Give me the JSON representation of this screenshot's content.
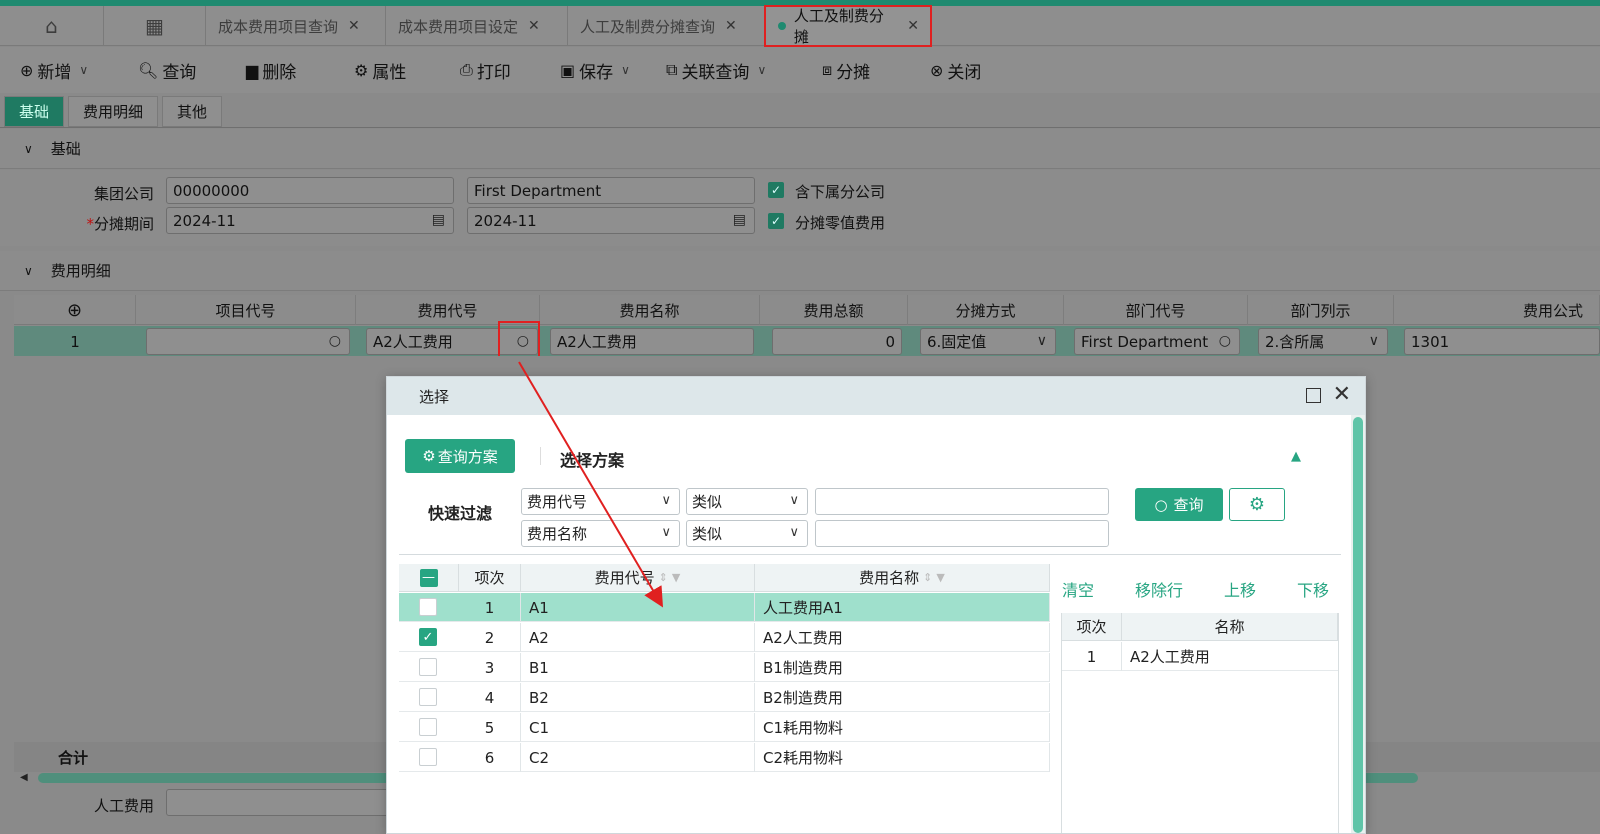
{
  "tabs": [
    {
      "label": "成本费用项目查询"
    },
    {
      "label": "成本费用项目设定"
    },
    {
      "label": "人工及制费分摊查询"
    },
    {
      "label": "人工及制费分摊"
    }
  ],
  "toolbar": {
    "new": "新增",
    "query": "查询",
    "delete": "删除",
    "properties": "属性",
    "print": "打印",
    "save": "保存",
    "related_query": "关联查询",
    "allocate": "分摊",
    "close": "关闭"
  },
  "subtabs": [
    "基础",
    "费用明细",
    "其他"
  ],
  "basic_section": {
    "title": "基础",
    "group_company_label": "集团公司",
    "group_company_code": "00000000",
    "group_company_name": "First Department",
    "period_label": "分摊期间",
    "period_from": "2024-11",
    "period_to": "2024-11",
    "include_subsidiaries": "含下属分公司",
    "allocate_petty": "分摊零值费用"
  },
  "detail_section": {
    "title": "费用明细",
    "columns": [
      "项目代号",
      "费用代号",
      "费用名称",
      "费用总额",
      "分摊方式",
      "部门代号",
      "部门列示",
      "费用公式"
    ],
    "row": {
      "index": "1",
      "item_code": "",
      "expense_code": "A2人工费用",
      "expense_name": "A2人工费用",
      "total": "0",
      "method": "6.固定值",
      "dept_code": "First Department",
      "dept_display": "2.含所属",
      "formula": "1301"
    },
    "sum_label": "合计",
    "footer_label": "人工费用"
  },
  "dialog": {
    "title": "选择",
    "query_plan_btn": "查询方案",
    "select_plan": "选择方案",
    "quick_filter": "快速过滤",
    "filters": [
      {
        "field": "费用代号",
        "op": "类似",
        "value": ""
      },
      {
        "field": "费用名称",
        "op": "类似",
        "value": ""
      }
    ],
    "query_btn": "查询",
    "columns": {
      "index": "项次",
      "code": "费用代号",
      "name": "费用名称"
    },
    "rows": [
      {
        "index": "1",
        "code": "A1",
        "name": "人工费用A1",
        "checked": false
      },
      {
        "index": "2",
        "code": "A2",
        "name": "A2人工费用",
        "checked": true
      },
      {
        "index": "3",
        "code": "B1",
        "name": "B1制造费用",
        "checked": false
      },
      {
        "index": "4",
        "code": "B2",
        "name": "B2制造费用",
        "checked": false
      },
      {
        "index": "5",
        "code": "C1",
        "name": "C1耗用物料",
        "checked": false
      },
      {
        "index": "6",
        "code": "C2",
        "name": "C2耗用物料",
        "checked": false
      }
    ],
    "right_actions": {
      "clear": "清空",
      "remove_row": "移除行",
      "move_up": "上移",
      "move_down": "下移"
    },
    "selected_columns": {
      "index": "项次",
      "name": "名称"
    },
    "selected_rows": [
      {
        "index": "1",
        "name": "A2人工费用"
      }
    ]
  },
  "colors": {
    "accent": "#27a582",
    "highlight": "#e02020"
  }
}
